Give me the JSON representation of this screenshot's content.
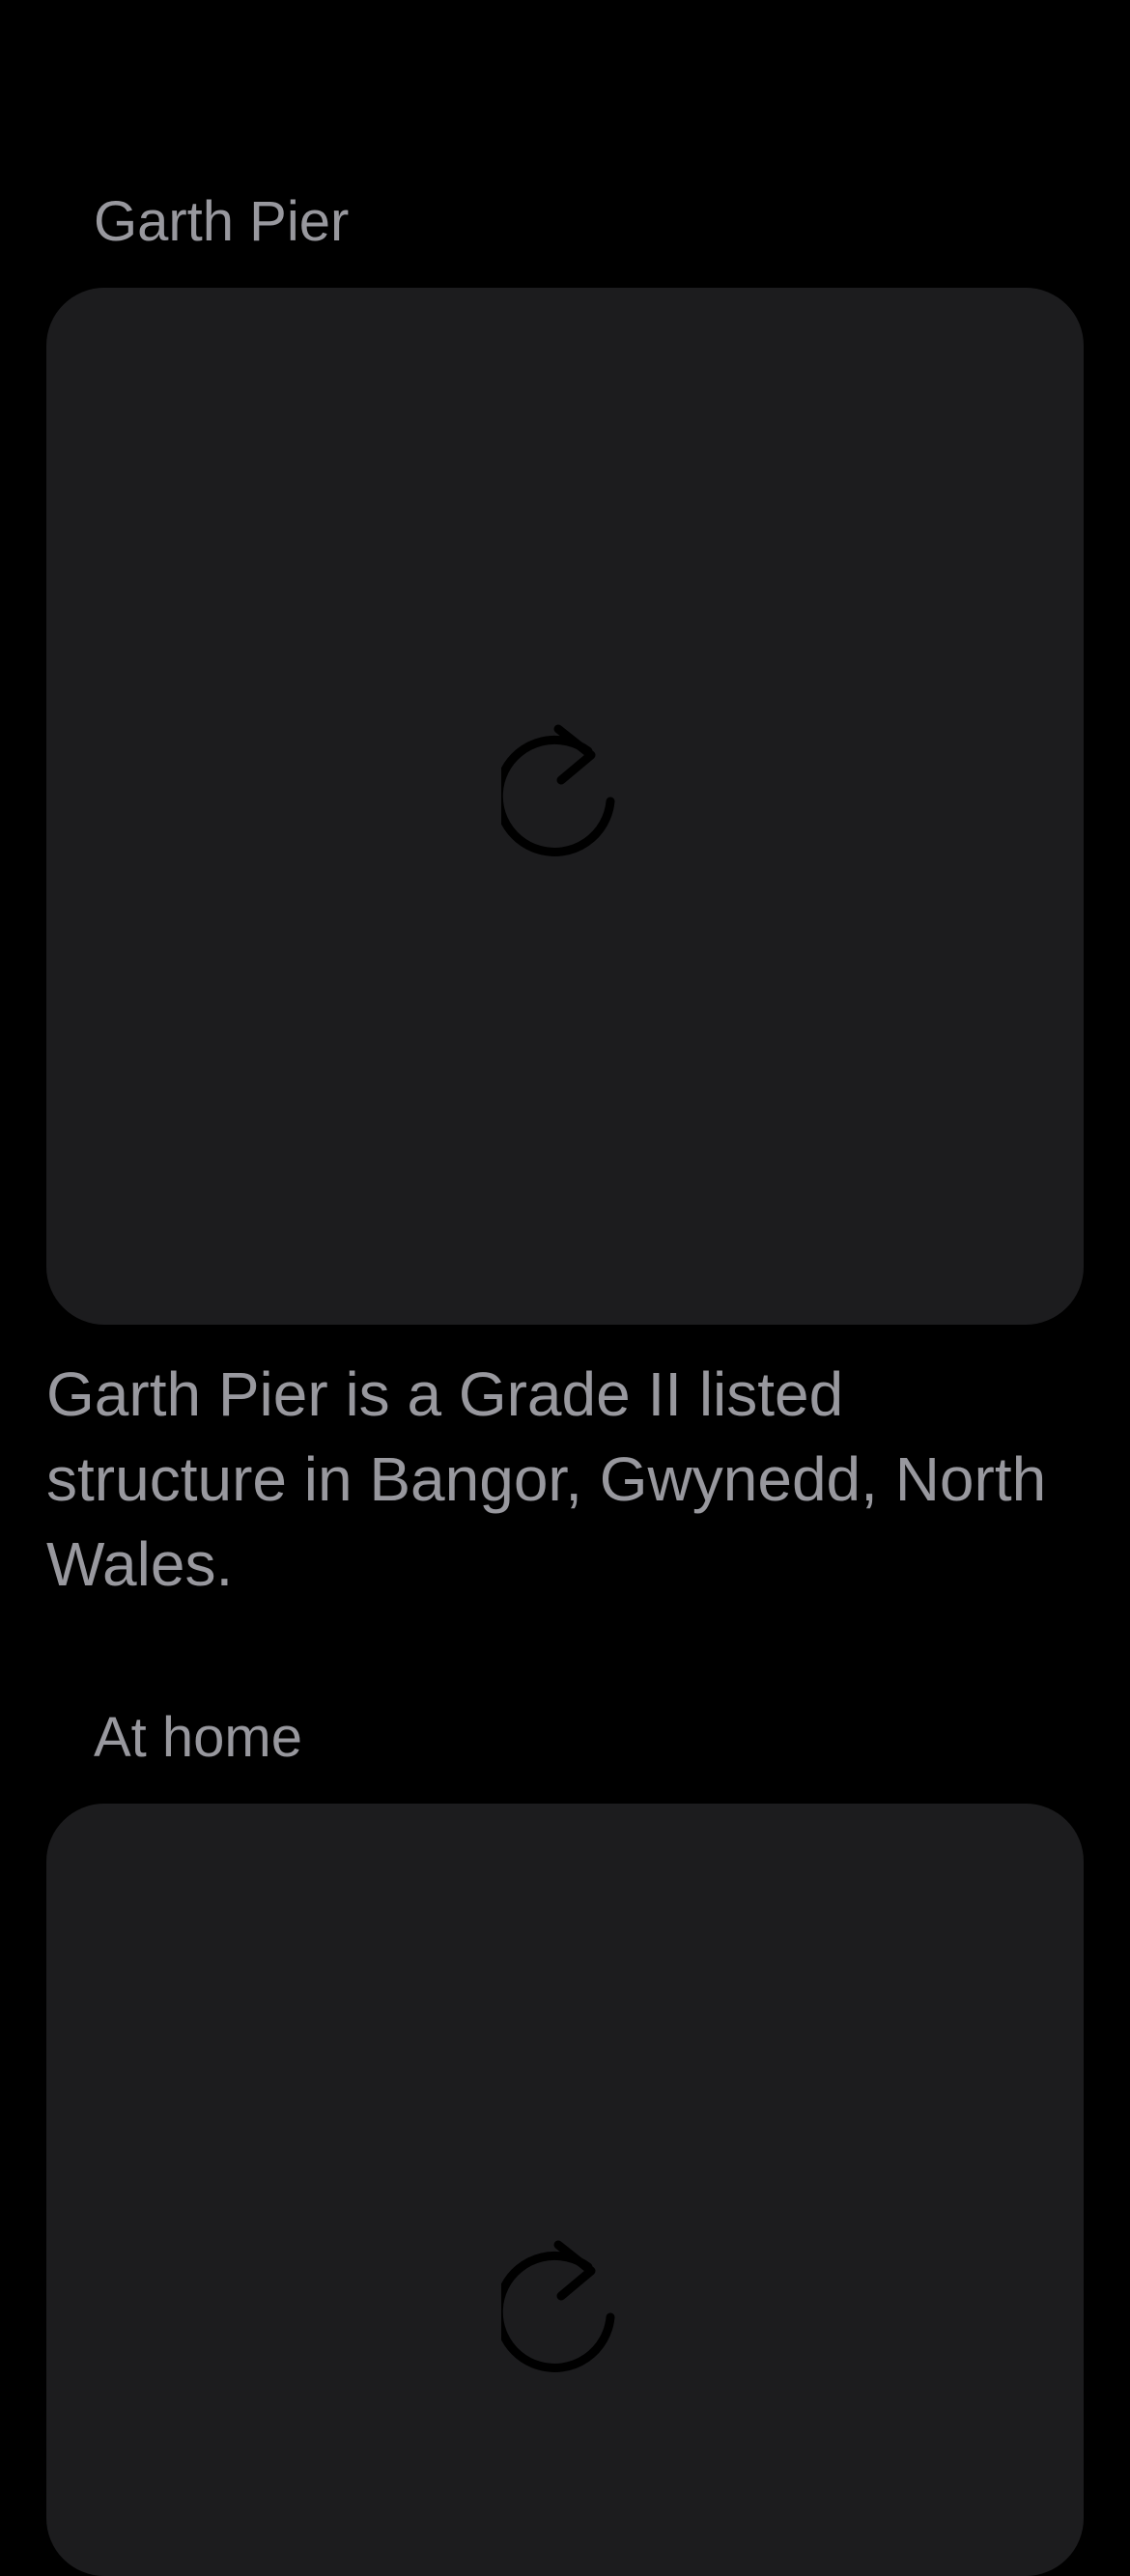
{
  "items": [
    {
      "title": "Garth Pier",
      "icon": "reload-icon",
      "caption": "Garth Pier is a Grade II listed structure in Bangor, Gwynedd, North Wales."
    },
    {
      "title": "At home",
      "icon": "reload-icon",
      "caption": ""
    }
  ],
  "colors": {
    "background": "#000000",
    "card": "#1c1c1e",
    "text": "#98989e",
    "icon": "#000000"
  }
}
